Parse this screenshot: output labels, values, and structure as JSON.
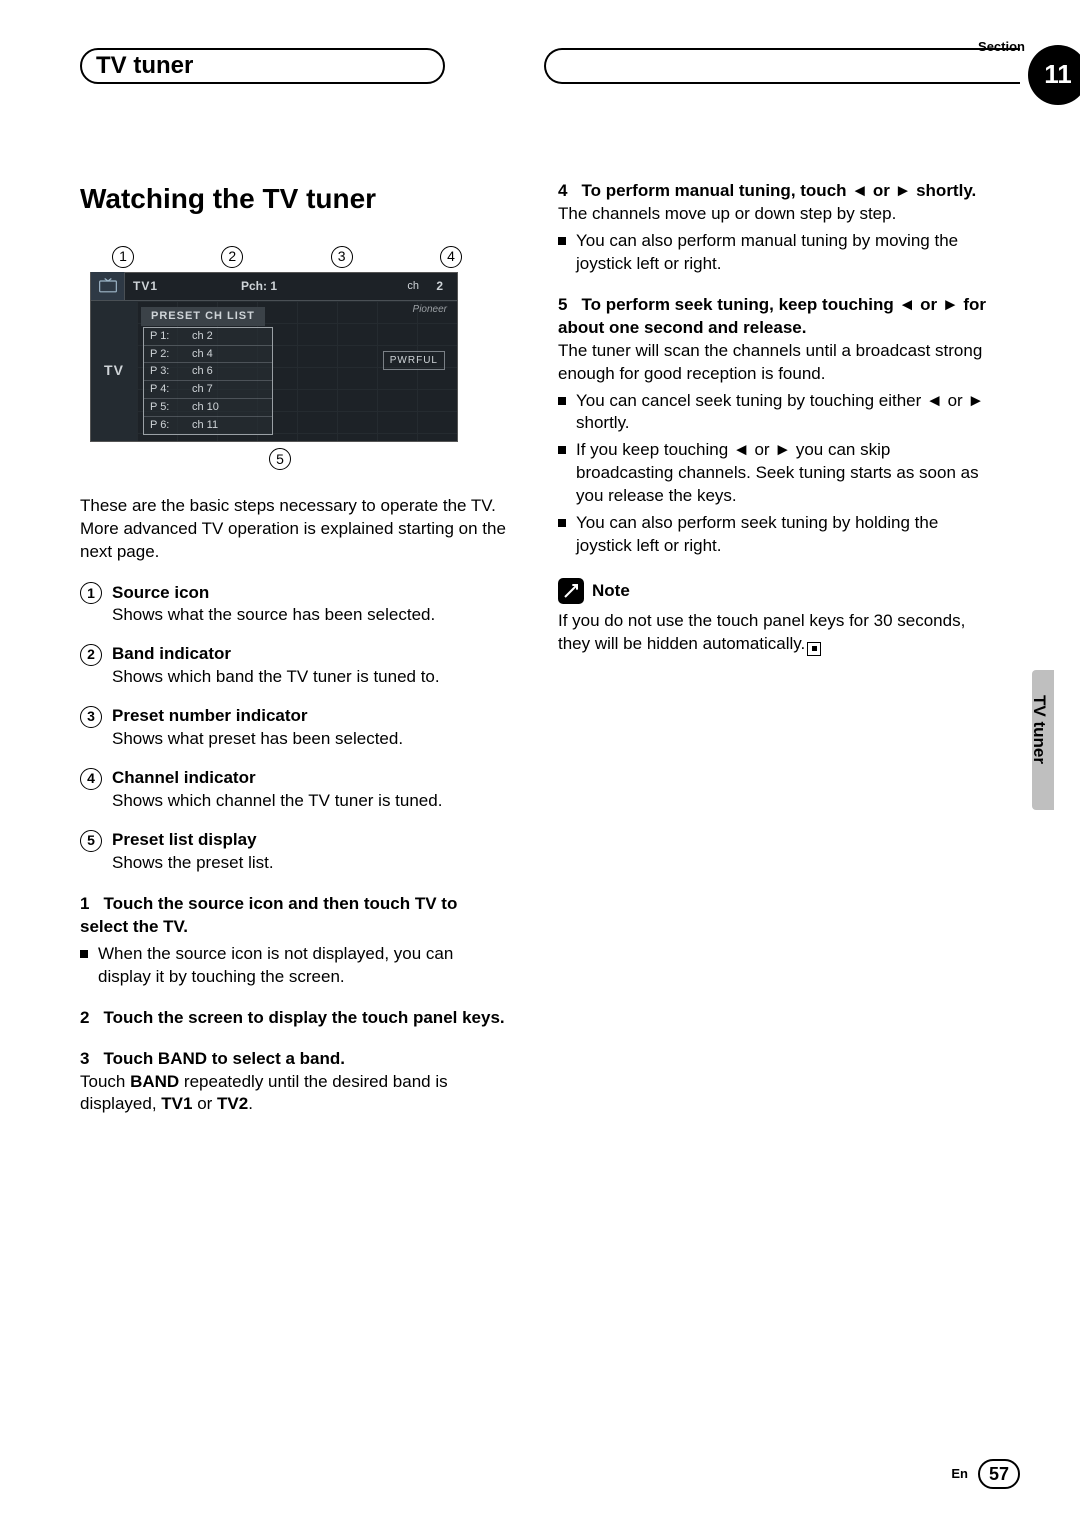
{
  "header": {
    "section_label": "Section",
    "title": "TV tuner",
    "section_number": "11"
  },
  "side": {
    "tab_label": "TV tuner"
  },
  "footer": {
    "lang": "En",
    "page": "57"
  },
  "left": {
    "h1": "Watching the TV tuner",
    "callouts_top": [
      "1",
      "2",
      "3",
      "4"
    ],
    "callouts_bot": [
      "5"
    ],
    "screenshot": {
      "tv_label": "TV",
      "band": "TV1",
      "pch_label": "Pch:",
      "pch_value": "1",
      "ch_label": "ch",
      "ch_value": "2",
      "brand": "Pioneer",
      "list_header": "PRESET CH LIST",
      "pwr": "PWRFUL",
      "presets": [
        {
          "p": "P 1:",
          "c": "ch 2"
        },
        {
          "p": "P 2:",
          "c": "ch 4"
        },
        {
          "p": "P 3:",
          "c": "ch 6"
        },
        {
          "p": "P 4:",
          "c": "ch 7"
        },
        {
          "p": "P 5:",
          "c": "ch 10"
        },
        {
          "p": "P 6:",
          "c": "ch 11"
        }
      ]
    },
    "intro": "These are the basic steps necessary to operate the TV. More advanced TV operation is explained starting on the next page.",
    "definitions": [
      {
        "num": "1",
        "title": "Source icon",
        "body": "Shows what the source has been selected."
      },
      {
        "num": "2",
        "title": "Band indicator",
        "body": "Shows which band the TV tuner is tuned to."
      },
      {
        "num": "3",
        "title": "Preset number indicator",
        "body": "Shows what preset has been selected."
      },
      {
        "num": "4",
        "title": "Channel indicator",
        "body": "Shows which channel the TV tuner is tuned."
      },
      {
        "num": "5",
        "title": "Preset list display",
        "body": "Shows the preset list."
      }
    ],
    "steps": [
      {
        "num": "1",
        "head": "Touch the source icon and then touch TV to select the TV.",
        "bullets": [
          "When the source icon is not displayed, you can display it by touching the screen."
        ]
      },
      {
        "num": "2",
        "head": "Touch the screen to display the touch panel keys.",
        "bullets": []
      },
      {
        "num": "3",
        "head": "Touch BAND to select a band.",
        "body_pre": "Touch ",
        "body_bold": "BAND",
        "body_post_a": " repeatedly until the desired band is displayed, ",
        "body_bold2": "TV1",
        "body_mid": " or ",
        "body_bold3": "TV2",
        "body_end": ".",
        "bullets": []
      }
    ]
  },
  "right": {
    "steps": [
      {
        "num": "4",
        "head_pre": "To perform manual tuning, touch ",
        "head_post": " shortly.",
        "body": "The channels move up or down step by step.",
        "bullets": [
          "You can also perform manual tuning by moving the joystick left or right."
        ]
      },
      {
        "num": "5",
        "head_pre": "To perform seek tuning, keep touching ",
        "head_post": " for about one second and release.",
        "body": "The tuner will scan the channels until a broadcast strong enough for good reception is found.",
        "bullets": []
      }
    ],
    "seek_bullets": {
      "b1_pre": "You can cancel seek tuning by touching either ",
      "b1_post": " shortly.",
      "b2_pre": "If you keep touching ",
      "b2_post": " you can skip broadcasting channels. Seek tuning starts as soon as you release the keys.",
      "b3": "You can also perform seek tuning by holding the joystick left or right."
    },
    "note": {
      "label": "Note",
      "body": "If you do not use the touch panel keys for 30 seconds, they will be hidden automatically."
    },
    "arrows": {
      "left": "◄",
      "right": "►",
      "or": " or "
    }
  }
}
